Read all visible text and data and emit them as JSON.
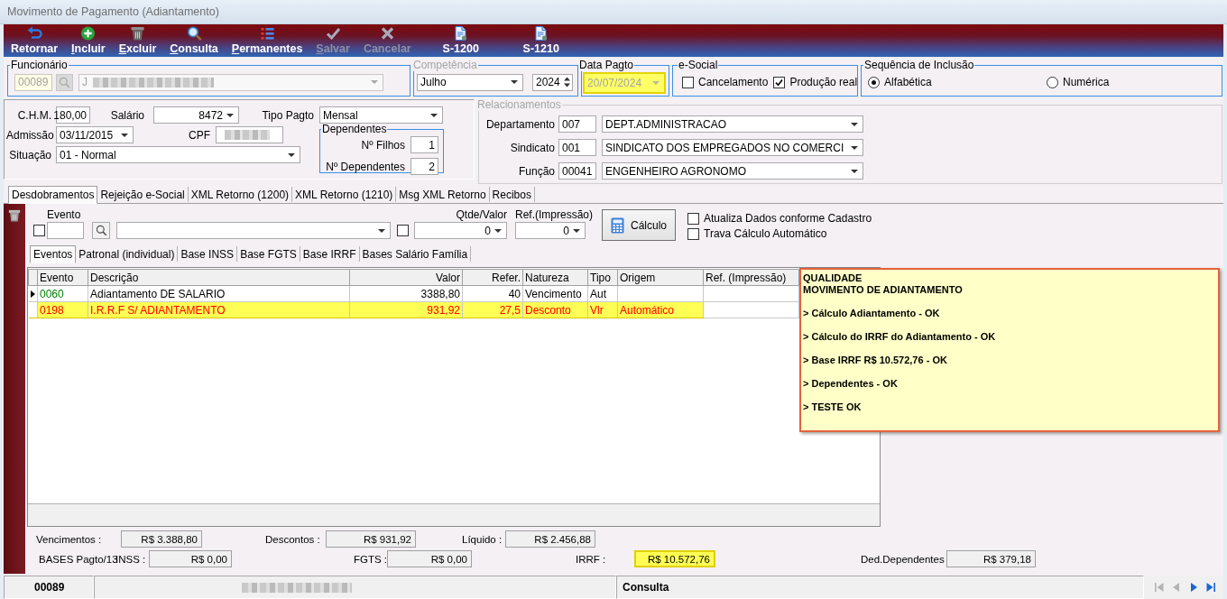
{
  "window": {
    "title": "Movimento de Pagamento (Adiantamento)"
  },
  "toolbar": [
    {
      "label": "Retornar",
      "mnemonic": false,
      "disabled": false
    },
    {
      "label": "Incluir",
      "mnemonic": true,
      "disabled": false
    },
    {
      "label": "Excluir",
      "mnemonic": true,
      "disabled": false
    },
    {
      "label": "Consulta",
      "mnemonic": true,
      "disabled": false
    },
    {
      "label": "Permanentes",
      "mnemonic": true,
      "disabled": false
    },
    {
      "label": "Salvar",
      "mnemonic": true,
      "disabled": true
    },
    {
      "label": "Cancelar",
      "mnemonic": false,
      "disabled": true
    },
    {
      "label": "S-1200",
      "mnemonic": false,
      "disabled": false
    },
    {
      "label": "S-1210",
      "mnemonic": false,
      "disabled": false
    }
  ],
  "funcionario": {
    "title": "Funcionário",
    "code": "00089",
    "name": "J",
    "disabled": true
  },
  "competencia": {
    "title": "Competência",
    "disabled": true,
    "month": "Julho",
    "year": "2024"
  },
  "data_pagto": {
    "title": "Data Pagto",
    "value": "20/07/2024",
    "disabled": true,
    "highlighted": true
  },
  "esocial": {
    "title": "e-Social",
    "options": [
      {
        "label": "Cancelamento",
        "checked": false
      },
      {
        "label": "Produção real",
        "checked": true
      }
    ]
  },
  "sequencia": {
    "title": "Sequência de Inclusão",
    "options": [
      {
        "label": "Alfabética",
        "selected": true
      },
      {
        "label": "Numérica",
        "selected": false
      }
    ]
  },
  "dados": {
    "chm": {
      "label": "C.H.M.",
      "value": "180,00"
    },
    "salario": {
      "label": "Salário",
      "value": "8472"
    },
    "tipo_pagto": {
      "label": "Tipo Pagto",
      "value": "Mensal"
    },
    "admissao": {
      "label": "Admissão",
      "value": "03/11/2015"
    },
    "cpf": {
      "label": "CPF"
    },
    "situacao": {
      "label": "Situação",
      "value": "01 - Normal"
    },
    "dependentes": {
      "title": "Dependentes",
      "fields": [
        {
          "label": "Nº Filhos",
          "value": "1"
        },
        {
          "label": "Nº Dependentes",
          "value": "2"
        }
      ]
    }
  },
  "relacionamentos": {
    "title": "Relacionamentos",
    "disabled": true,
    "rows": [
      {
        "label": "Departamento",
        "code": "007",
        "name": "DEPT.ADMINISTRACAO"
      },
      {
        "label": "Sindicato",
        "code": "001",
        "name": "SINDICATO DOS EMPREGADOS NO COMERCI"
      },
      {
        "label": "Função",
        "code": "00041",
        "name": "ENGENHEIRO AGRONOMO"
      }
    ]
  },
  "tabs": [
    {
      "label": "Desdobramentos",
      "selected": true
    },
    {
      "label": "Rejeição e-Social",
      "selected": false
    },
    {
      "label": "XML Retorno (1200)",
      "selected": false
    },
    {
      "label": "XML Retorno (1210)",
      "selected": false
    },
    {
      "label": "Msg XML Retorno",
      "selected": false
    },
    {
      "label": "Recibos",
      "selected": false
    }
  ],
  "evento_bar": {
    "evento_label": "Evento",
    "evento_checked": false,
    "description_checked": false,
    "qtde_label": "Qtde/Valor",
    "qtde_value": "0",
    "ref_label": "Ref.(Impressão)",
    "ref_value": "0",
    "calc_label": "Cálculo",
    "options": [
      {
        "label": "Atualiza Dados conforme Cadastro",
        "checked": false
      },
      {
        "label": "Trava Cálculo Automático",
        "checked": false
      }
    ]
  },
  "subtabs": [
    {
      "label": "Eventos",
      "selected": true
    },
    {
      "label": "Patronal (individual)",
      "selected": false
    },
    {
      "label": "Base INSS",
      "selected": false
    },
    {
      "label": "Base FGTS",
      "selected": false
    },
    {
      "label": "Base IRRF",
      "selected": false
    },
    {
      "label": "Bases Salário Família",
      "selected": false
    }
  ],
  "grid": {
    "columns": [
      "Evento",
      "Descrição",
      "Valor",
      "Refer.",
      "Natureza",
      "Tipo",
      "Origem",
      "Ref. (Impressão)"
    ],
    "rows": [
      {
        "kind": "earning",
        "current": true,
        "highlighted": false,
        "evento": "0060",
        "descricao": "Adiantamento DE SALARIO",
        "valor": "3388,80",
        "refer": "40",
        "natureza": "Vencimento",
        "tipo": "Aut"
      },
      {
        "kind": "deduction",
        "current": false,
        "highlighted": true,
        "evento": "0198",
        "descricao": "I.R.R.F S/ ADIANTAMENTO",
        "valor": "931,92",
        "refer": "27,5",
        "natureza": "Desconto",
        "tipo": "Vlr",
        "origem": "Automático"
      }
    ]
  },
  "note": {
    "title_lines": [
      "QUALIDADE",
      "MOVIMENTO DE ADIANTAMENTO"
    ],
    "items": [
      "> Cálculo Adiantamento - OK",
      "> Cálculo do IRRF do Adiantamento - OK",
      "> Base IRRF R$ 10.572,76 - OK",
      "> Dependentes - OK",
      "> TESTE OK"
    ]
  },
  "totals": {
    "row1": [
      {
        "label": "Vencimentos :",
        "value": "R$ 3.388,80",
        "highlighted": false
      },
      {
        "label": "Descontos :",
        "value": "R$ 931,92",
        "highlighted": false
      },
      {
        "label": "Líquido :",
        "value": "R$ 2.456,88",
        "highlighted": false
      }
    ],
    "bases_label": "BASES Pagto/13",
    "row2": [
      {
        "label": "INSS :",
        "value": "R$ 0,00",
        "highlighted": false
      },
      {
        "label": "FGTS :",
        "value": "R$ 0,00",
        "highlighted": false
      },
      {
        "label": "IRRF :",
        "value": "R$ 10.572,76",
        "highlighted": true
      },
      {
        "label": "Ded.Dependentes",
        "value": "R$ 379,18",
        "highlighted": false
      }
    ]
  },
  "status_bar": {
    "code": "00089",
    "mode": "Consulta",
    "nav": [
      {
        "disabled": true
      },
      {
        "disabled": true
      },
      {
        "disabled": false
      },
      {
        "disabled": false
      }
    ]
  }
}
